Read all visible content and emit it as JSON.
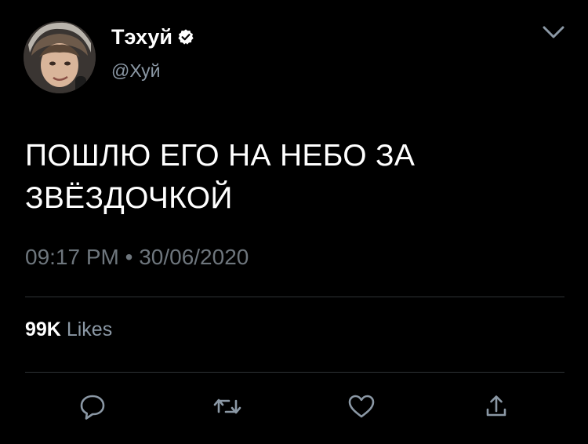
{
  "tweet": {
    "display_name": "Тэхуй",
    "handle": "@Хуй",
    "text_lines": [
      "ПОШЛЮ ЕГО НА НЕБО ЗА",
      "ЗВЁЗДОЧКОЙ"
    ],
    "timestamp": "09:17 PM • 30/06/2020",
    "likes_count": "99K",
    "likes_label": "Likes"
  },
  "icons": {
    "verified": "verified-badge-icon",
    "menu": "chevron-down-icon",
    "reply": "reply-icon",
    "retweet": "retweet-icon",
    "like": "heart-icon",
    "share": "share-icon"
  },
  "colors": {
    "background": "#000000",
    "primary_text": "#ffffff",
    "secondary_text": "#8b98a5",
    "timestamp_text": "#6e767d",
    "divider": "#2f3336",
    "icon": "#8b98a5"
  }
}
